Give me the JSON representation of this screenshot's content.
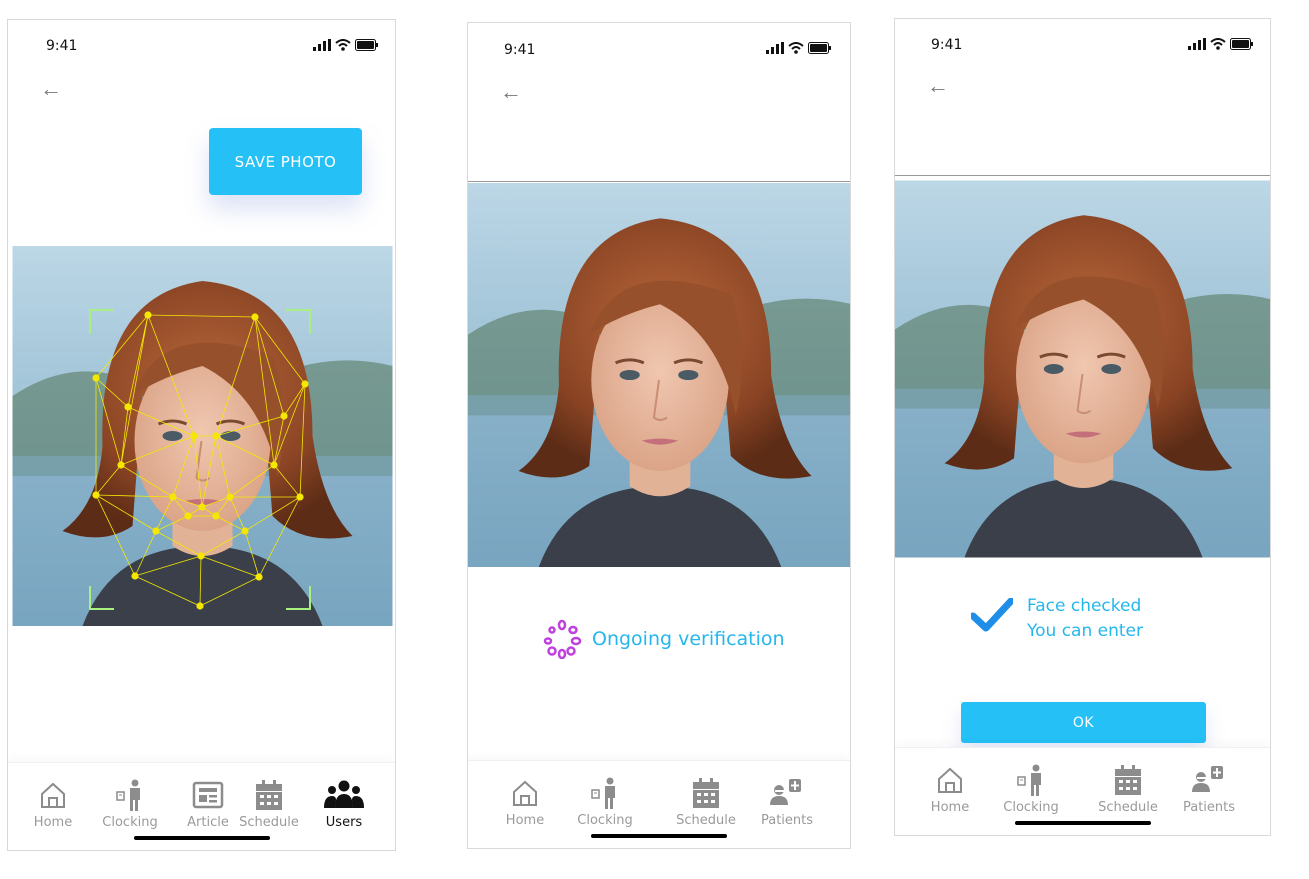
{
  "screens": [
    {
      "status_time": "9:41",
      "save_label": "SAVE PHOTO",
      "tabs": [
        "Home",
        "Clocking",
        "Article",
        "Schedule",
        "Users"
      ],
      "active_tab": "Users"
    },
    {
      "status_time": "9:41",
      "status_label": "Ongoing verification",
      "tabs": [
        "Home",
        "Clocking",
        "Schedule",
        "Patients"
      ]
    },
    {
      "status_time": "9:41",
      "result_line1": "Face checked",
      "result_line2": "You can enter",
      "ok_label": "OK",
      "tabs": [
        "Home",
        "Clocking",
        "Schedule",
        "Patients"
      ]
    }
  ],
  "colors": {
    "accent": "#25c0f5",
    "accent_text": "#25b7ec",
    "spinner": "#c040e0",
    "landmark": "#f5e800",
    "frame_corner": "#a8f080"
  },
  "icons": [
    "back-arrow-icon",
    "signal-icon",
    "wifi-icon",
    "battery-icon",
    "home-icon",
    "clocking-icon",
    "article-icon",
    "schedule-icon",
    "users-icon",
    "patients-icon",
    "check-icon",
    "spinner-icon"
  ]
}
